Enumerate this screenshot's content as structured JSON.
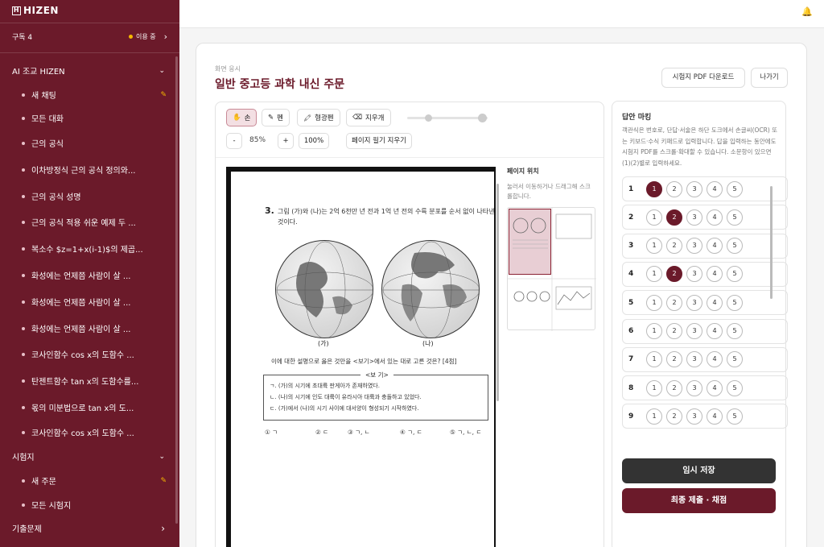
{
  "sidebar": {
    "logo": "HIZEN",
    "logo_icon": "H",
    "subscription_label": "구독 4",
    "subscription_status": "이용 중",
    "section_ai": "AI 조교 HIZEN",
    "ai_items": [
      {
        "label": "새 채팅",
        "edit": true
      },
      {
        "label": "모든 대화"
      },
      {
        "label": "근의 공식"
      },
      {
        "label": "이차방정식 근의 공식 정의와..."
      },
      {
        "label": "근의 공식 성명"
      },
      {
        "label": "근의 공식 적용 쉬운 예제 두 ..."
      },
      {
        "label": "복소수 $z=1+x(i-1)$의 제곱..."
      },
      {
        "label": "화성에는 언제쯤 사람이 살 ..."
      },
      {
        "label": "화성에는 언제쯤 사람이 살 ..."
      },
      {
        "label": "화성에는 언제쯤 사람이 살 ..."
      },
      {
        "label": "코사인함수 cos x의 도함수 ..."
      },
      {
        "label": "탄젠트함수 tan x의 도함수를..."
      },
      {
        "label": "몫의 미분법으로 tan x의 도..."
      },
      {
        "label": "코사인함수 cos x의 도함수 ..."
      }
    ],
    "section_exam": "시험지",
    "exam_items": [
      {
        "label": "새 주문",
        "edit": true
      },
      {
        "label": "모든 시험지"
      }
    ],
    "section_past": "기출문제"
  },
  "header": {
    "bell_icon": "bell-icon",
    "bell": "🔔"
  },
  "main": {
    "subtitle": "화면 응시",
    "title": "일반 중고등 과학 내신 주문",
    "download_label": "시험지 PDF 다운로드",
    "exit_label": "나가기"
  },
  "toolbar": {
    "hand": "손",
    "hand_glyph": "✋",
    "pen": "펜",
    "pen_glyph": "✎",
    "highlighter": "형광펜",
    "highlighter_glyph": "🖍",
    "eraser": "지우개",
    "eraser_glyph": "⌫",
    "zoom_minus": "-",
    "zoom_value": "85%",
    "zoom_plus": "+",
    "zoom_reset": "100%",
    "clear_page": "페이지 필기 지우기"
  },
  "question": {
    "number": "3.",
    "text": "그림 (가)와 (나)는 2억 6천만 년 전과 1억 년 전의 수륙 분포를 순서 없이 나타낸 것이다.",
    "label_a": "(가)",
    "label_b": "(나)",
    "prompt": "이에 대한 설명으로 옳은 것만을 <보기>에서 있는 대로 고른 것은? [4점]",
    "bogi_header": "<보  기>",
    "bogi_lines": [
      "ㄱ. (가)의 시기에 초대륙 판게아가 존재하였다.",
      "ㄴ. (나)의 시기에 인도 대륙이 유라시아 대륙과 충돌하고 있었다.",
      "ㄷ. (가)에서 (나)의 시기 사이에 대서양이 형성되기 시작하였다."
    ],
    "choices": [
      "① ㄱ",
      "② ㄷ",
      "③ ㄱ, ㄴ",
      "④ ㄱ, ㄷ",
      "⑤ ㄱ, ㄴ, ㄷ"
    ]
  },
  "page_nav": {
    "title": "페이지 위치",
    "desc": "눌러서 이동하거나 드래그해 스크롤합니다."
  },
  "answers": {
    "title": "답안 마킹",
    "desc": "객관식은 번호로, 단답·서술은 하단 도크에서 손글씨(OCR) 또는 키보드·수식 키패드로 입력합니다. 답을 입력하는 동안에도 시험지 PDF를 스크롤·확대할 수 있습니다. 소문항이 있으면 (1)(2)별로 입력하세요.",
    "options": [
      "1",
      "2",
      "3",
      "4",
      "5"
    ],
    "rows": [
      {
        "n": "1",
        "sel": 1
      },
      {
        "n": "2",
        "sel": 2
      },
      {
        "n": "3",
        "sel": 0
      },
      {
        "n": "4",
        "sel": 2
      },
      {
        "n": "5",
        "sel": 0
      },
      {
        "n": "6",
        "sel": 0
      },
      {
        "n": "7",
        "sel": 0
      },
      {
        "n": "8",
        "sel": 0
      },
      {
        "n": "9",
        "sel": 0
      }
    ],
    "save_label": "임시 저장",
    "submit_label": "최종 제출 · 채점"
  },
  "colors": {
    "brand": "#6b1a2a",
    "dark_button": "#333333",
    "accent": "#f5b800"
  }
}
